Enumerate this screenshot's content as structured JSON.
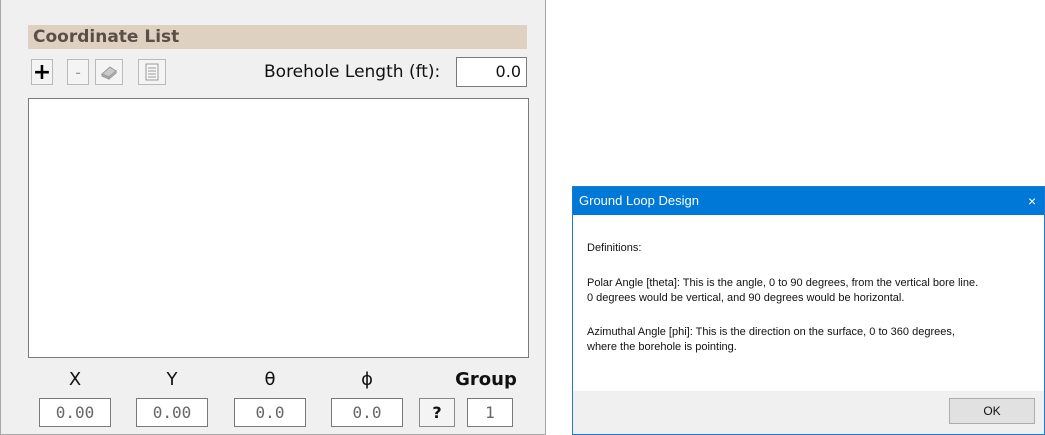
{
  "panel": {
    "header": "Coordinate List",
    "toolbar": {
      "add_label": "+",
      "remove_label": "-"
    },
    "borehole_length_label": "Borehole Length (ft):",
    "borehole_length_value": "0.0",
    "columns": {
      "x": "X",
      "y": "Y",
      "theta": "θ",
      "phi": "ϕ",
      "group": "Group"
    },
    "values": {
      "x": "0.00",
      "y": "0.00",
      "theta": "0.0",
      "phi": "0.0",
      "group": "1"
    },
    "help_label": "?"
  },
  "dialog": {
    "title": "Ground Loop Design",
    "close_label": "×",
    "definitions": "Definitions:",
    "polar_line1": "Polar Angle [theta]: This is the angle, 0 to 90 degrees, from the vertical bore line.",
    "polar_line2": "0 degrees would be vertical, and 90 degrees would be horizontal.",
    "azimuthal_line1": "Azimuthal Angle [phi]: This is the direction on the surface, 0 to 360 degrees,",
    "azimuthal_line2": "where the borehole is pointing.",
    "ok_label": "OK"
  }
}
